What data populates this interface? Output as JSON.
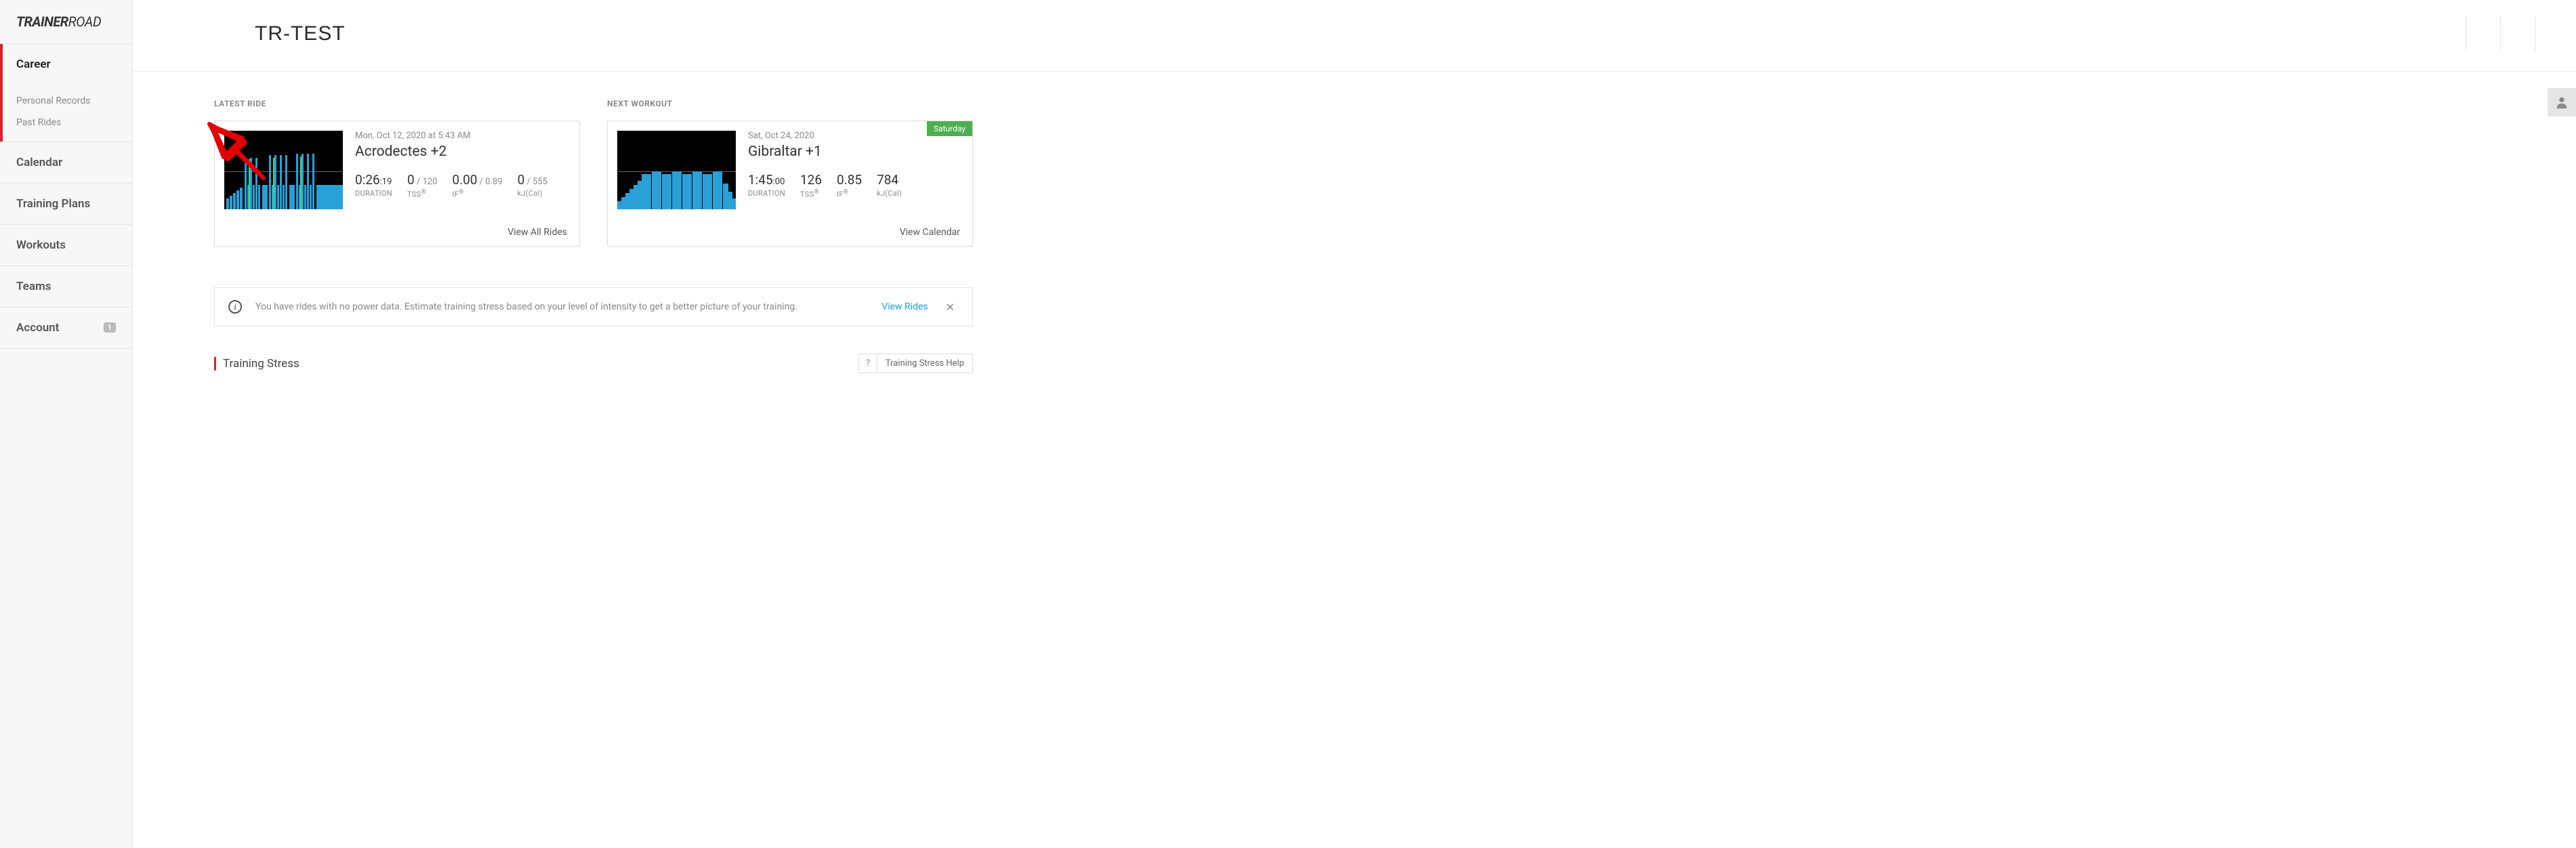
{
  "logo": {
    "part1": "TRAINER",
    "part2": "ROAD"
  },
  "sidebar": {
    "career": "Career",
    "subs": [
      "Personal Records",
      "Past Rides"
    ],
    "items": [
      "Calendar",
      "Training Plans",
      "Workouts",
      "Teams",
      "Account"
    ],
    "account_badge": "1"
  },
  "header": {
    "title": "TR-TEST"
  },
  "latest": {
    "label": "LATEST RIDE",
    "date": "Mon, Oct 12, 2020 at 5:43 AM",
    "title": "Acrodectes +2",
    "duration": {
      "main": "0:26",
      "sec": ":19",
      "label": "DURATION"
    },
    "tss": {
      "main": "0",
      "sec": " / 120",
      "label": "TSS"
    },
    "if": {
      "main": "0.00",
      "sec": " / 0.89",
      "label": "IF"
    },
    "kj": {
      "main": "0",
      "sec": " / 555",
      "label": "kJ(Cal)"
    },
    "footer": "View All Rides"
  },
  "next": {
    "label": "NEXT WORKOUT",
    "date": "Sat, Oct 24, 2020",
    "title": "Gibraltar +1",
    "day": "Saturday",
    "duration": {
      "main": "1:45",
      "sec": ":00",
      "label": "DURATION"
    },
    "tss": {
      "main": "126",
      "label": "TSS"
    },
    "if": {
      "main": "0.85",
      "label": "IF"
    },
    "kj": {
      "main": "784",
      "label": "kJ(Cal)"
    },
    "footer": "View Calendar"
  },
  "alert": {
    "text": "You have rides with no power data. Estimate training stress based on your level of intensity to get a better picture of your training.",
    "link": "View Rides"
  },
  "stress": {
    "title": "Training Stress",
    "help": "Training Stress Help"
  }
}
